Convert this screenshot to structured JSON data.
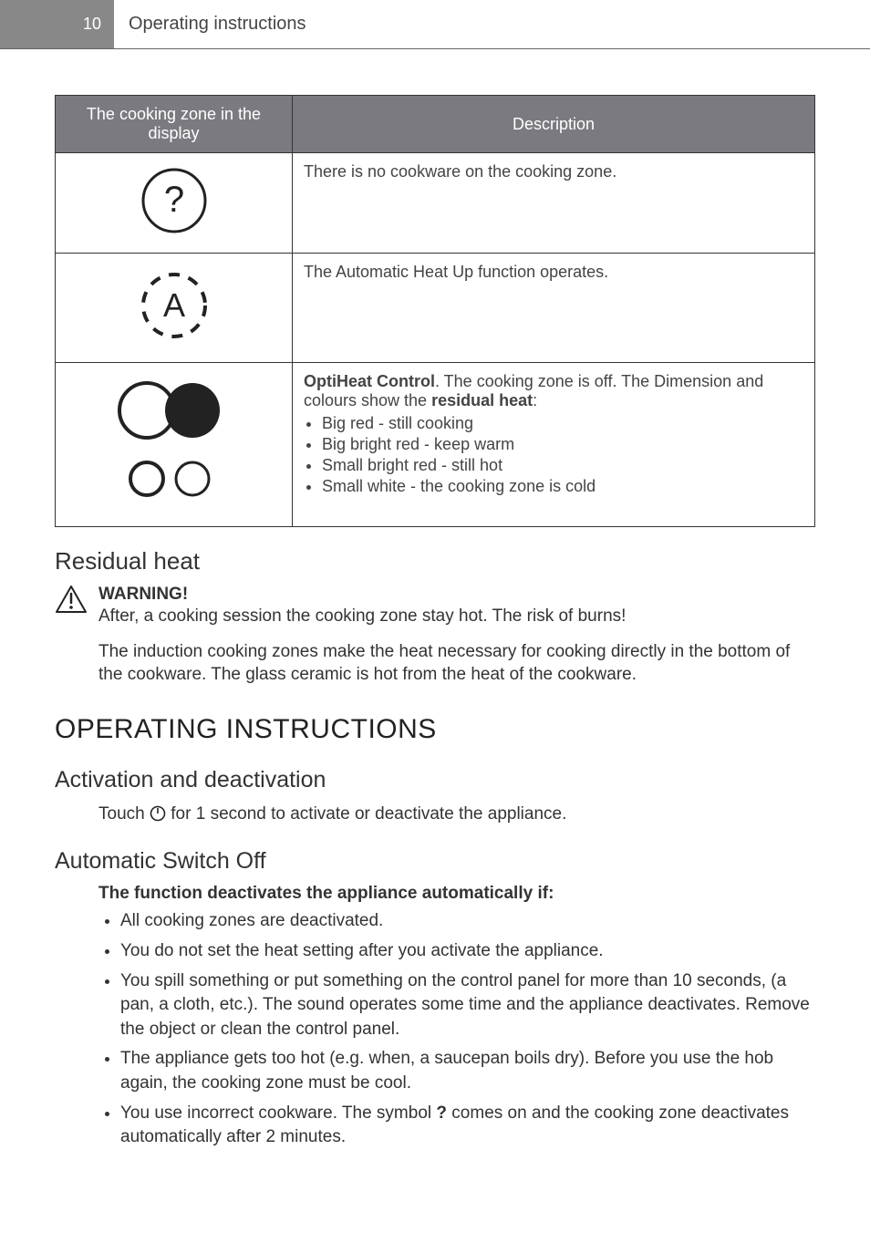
{
  "header": {
    "page_number": "10",
    "title": "Operating instructions"
  },
  "table": {
    "col1": "The cooking zone in the display",
    "col2": "Description",
    "rows": [
      {
        "icon": "question",
        "desc_plain": "There is no cookware on the cooking zone."
      },
      {
        "icon": "auto",
        "desc_plain": "The Automatic Heat Up function operates."
      },
      {
        "icon": "optiheat",
        "lead_bold1": "OptiHeat Control",
        "lead_mid": ". The cooking zone is off. The Dimension and colours show the ",
        "lead_bold2": "residual heat",
        "lead_end": ":",
        "items": [
          "Big red - still cooking",
          "Big bright red - keep warm",
          "Small bright red - still hot",
          "Small white - the cooking zone is cold"
        ]
      }
    ]
  },
  "residual": {
    "heading": "Residual heat",
    "warn_title": "WARNING!",
    "warn_text": "After, a cooking session the cooking zone stay hot. The risk of burns!",
    "para": "The induction cooking zones make the heat necessary for cooking directly in the bottom of the cookware. The glass ceramic is hot from the heat of the cookware."
  },
  "operating": {
    "heading": "OPERATING INSTRUCTIONS",
    "activation": {
      "heading": "Activation and deactivation",
      "text_before": "Touch ",
      "text_after": " for 1 second to activate or deactivate the appliance."
    },
    "auto_off": {
      "heading": "Automatic Switch Off",
      "lead": "The function deactivates the appliance automatically if:",
      "items": [
        "All cooking zones are deactivated.",
        "You do not set the heat setting after you activate the appliance.",
        "You spill something or put something on the control panel for more than 10 seconds, (a pan, a cloth, etc.). The sound operates some time and the appliance deactivates. Remove the object or clean the control panel.",
        "The appliance gets too hot (e.g. when, a saucepan boils dry). Before you use the hob again, the cooking zone must be cool."
      ],
      "last_item_before": "You use incorrect cookware. The symbol ",
      "last_item_after": " comes on and the cooking zone deactivates automatically after 2 minutes."
    }
  },
  "glyphs": {
    "incorrect_cookware": "?"
  }
}
